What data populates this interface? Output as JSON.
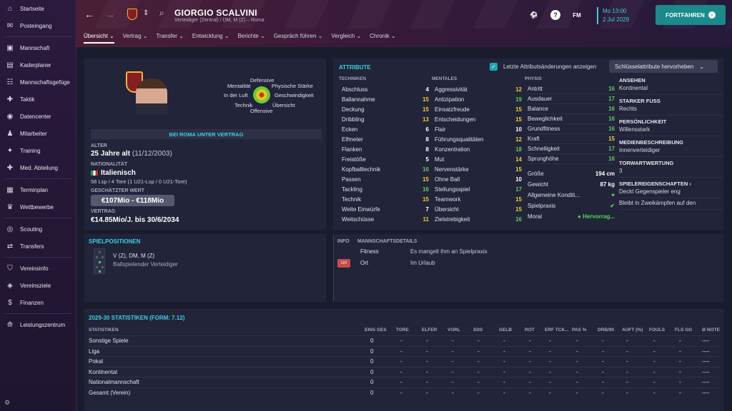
{
  "sidebar": {
    "items": [
      {
        "label": "Startseite",
        "icon": "home-icon"
      },
      {
        "label": "Posteingang",
        "icon": "inbox-icon"
      },
      {
        "label": "Mannschaft",
        "icon": "shirt-icon"
      },
      {
        "label": "Kaderplaner",
        "icon": "clipboard-icon"
      },
      {
        "label": "Mannschaftsgefüge",
        "icon": "people-icon"
      },
      {
        "label": "Taktik",
        "icon": "tactics-icon"
      },
      {
        "label": "Datencenter",
        "icon": "data-icon"
      },
      {
        "label": "Mitarbeiter",
        "icon": "staff-icon"
      },
      {
        "label": "Training",
        "icon": "training-icon"
      },
      {
        "label": "Med. Abteilung",
        "icon": "medical-icon"
      },
      {
        "label": "Terminplan",
        "icon": "calendar-icon"
      },
      {
        "label": "Wettbewerbe",
        "icon": "trophy-icon"
      },
      {
        "label": "Scouting",
        "icon": "scouting-icon"
      },
      {
        "label": "Transfers",
        "icon": "transfer-icon"
      },
      {
        "label": "Vereinsinfo",
        "icon": "shield-icon"
      },
      {
        "label": "Vereinsziele",
        "icon": "target-icon"
      },
      {
        "label": "Finanzen",
        "icon": "money-icon"
      },
      {
        "label": "Leistungszentrum",
        "icon": "academy-icon"
      }
    ]
  },
  "header": {
    "name": "GIORGIO SCALVINI",
    "subtitle": "Verteidiger (Zentral) / DM, M (Z) – Roma",
    "time": "Mo 13:00",
    "date": "2 Jul 2029",
    "fm_label": "FM",
    "help_label": "?",
    "continue_label": "FORTFAHREN",
    "tabs": [
      "Übersicht",
      "Vertrag",
      "Transfer",
      "Entwicklung",
      "Berichte",
      "Gespräch führen",
      "Vergleich",
      "Chronik"
    ]
  },
  "profile": {
    "radar_labels": {
      "top": "Defensive",
      "tl": "Mentalität",
      "tr": "Physische Stärke",
      "l": "In der Luft",
      "r": "Geschwindigkeit",
      "bl": "Technik",
      "br": "Übersicht",
      "bottom": "Offensive"
    },
    "contract_banner": "BEI ROMA UNTER VERTRAG",
    "age_label": "ALTER",
    "age": "25 Jahre alt",
    "dob": "(11/12/2003)",
    "nat_label": "NATIONALITÄT",
    "nationality": "Italienisch",
    "caps": "56 Lsp / 4 Tore (1 U21-Lsp / 0 U21-Tore)",
    "value_label": "GESCHÄTZTER WERT",
    "value": "€107Mio - €118Mio",
    "contract_label": "VERTRAG",
    "contract": "€14.85Mio/J. bis 30/6/2034"
  },
  "attributes": {
    "title": "ATTRIBUTE",
    "show_changes": "Letzte Attributsänderungen anzeigen",
    "key_button": "Schlüsselattribute hervorheben",
    "technik_head": "TECHNIKEN",
    "mental_head": "MENTALES",
    "physis_head": "PHYSIS",
    "technik": [
      {
        "n": "Abschluss",
        "v": "4"
      },
      {
        "n": "Ballannahme",
        "v": "15"
      },
      {
        "n": "Deckung",
        "v": "15"
      },
      {
        "n": "Dribbling",
        "v": "13"
      },
      {
        "n": "Ecken",
        "v": "6"
      },
      {
        "n": "Elfmeter",
        "v": "8"
      },
      {
        "n": "Flanken",
        "v": "8"
      },
      {
        "n": "Freistöße",
        "v": "5"
      },
      {
        "n": "Kopfballtechnik",
        "v": "16"
      },
      {
        "n": "Passen",
        "v": "15"
      },
      {
        "n": "Tackling",
        "v": "16"
      },
      {
        "n": "Technik",
        "v": "15"
      },
      {
        "n": "Weite Einwürfe",
        "v": "7"
      },
      {
        "n": "Weitschüsse",
        "v": "11"
      }
    ],
    "mental": [
      {
        "n": "Aggressivität",
        "v": "12"
      },
      {
        "n": "Antizipation",
        "v": "19"
      },
      {
        "n": "Einsatzfreude",
        "v": "15"
      },
      {
        "n": "Entscheidungen",
        "v": "15"
      },
      {
        "n": "Flair",
        "v": "10"
      },
      {
        "n": "Führungsqualitäten",
        "v": "12"
      },
      {
        "n": "Konzentration",
        "v": "18"
      },
      {
        "n": "Mut",
        "v": "14"
      },
      {
        "n": "Nervenstärke",
        "v": "15"
      },
      {
        "n": "Ohne Ball",
        "v": "10"
      },
      {
        "n": "Stellungsspiel",
        "v": "17"
      },
      {
        "n": "Teamwork",
        "v": "15"
      },
      {
        "n": "Übersicht",
        "v": "15"
      },
      {
        "n": "Zielstrebigkeit",
        "v": "16"
      }
    ],
    "physis": [
      {
        "n": "Antritt",
        "v": "16"
      },
      {
        "n": "Ausdauer",
        "v": "17"
      },
      {
        "n": "Balance",
        "v": "16"
      },
      {
        "n": "Beweglichkeit",
        "v": "16"
      },
      {
        "n": "Grundfitness",
        "v": "16"
      },
      {
        "n": "Kraft",
        "v": "15"
      },
      {
        "n": "Schnelligkeit",
        "v": "17"
      },
      {
        "n": "Sprunghöhe",
        "v": "16"
      }
    ],
    "extra": [
      {
        "n": "Größe",
        "v": "194 cm"
      },
      {
        "n": "Gewicht",
        "v": "87 kg"
      },
      {
        "n": "Allgemeine Konditi...",
        "v": "♥"
      },
      {
        "n": "Spielpraxis",
        "v": "✔"
      },
      {
        "n": "Moral",
        "v": "● Hervorrag..."
      }
    ],
    "right": [
      {
        "h": "ANSEHEN",
        "v": "Kontinental"
      },
      {
        "h": "STARKER FUSS",
        "v": "Rechts"
      },
      {
        "h": "PERSÖNLICHKEIT",
        "v": "Willensstark"
      },
      {
        "h": "MEDIENBESCHREIBUNG",
        "v": "Innenverteidiger"
      },
      {
        "h": "TORWARTWERTUNG",
        "v": "3"
      },
      {
        "h": "SPIELEREIGENSCHAFTEN ›",
        "v": "Deckt Gegenspieler eng"
      },
      {
        "h": "",
        "v": "Bleibt in Zweikämpfen auf den"
      }
    ]
  },
  "positions": {
    "title": "SPIELPOSITIONEN",
    "pos": "V (Z), DM, M (Z)",
    "role": "Ballspielender Verteidiger"
  },
  "info": {
    "tab_info": "INFO",
    "tab_details": "MANNSCHAFTSDETAILS",
    "rows": [
      {
        "k": "Fitness",
        "v": "Es mangelt ihm an Spielpraxis",
        "badge": ""
      },
      {
        "k": "Ort",
        "v": "Im Urlaub",
        "badge": "Url"
      }
    ]
  },
  "stats": {
    "title": "2029-30 STATISTIKEN (FORM: 7.12)",
    "headers": [
      "STATISTIKEN",
      "EINS GES",
      "TORE",
      "ELFER",
      "VORL",
      "SDS",
      "GELB",
      "ROT",
      "ERF TCK...",
      "PAS %",
      "DRB/90",
      "AUFT (%)",
      "FOULS",
      "FLS GG",
      "Ø NOTE"
    ],
    "rows": [
      {
        "name": "Sonstige Spiele",
        "apps": "0",
        "d": "-",
        "note": "----"
      },
      {
        "name": "Liga",
        "apps": "0",
        "d": "-",
        "note": "----"
      },
      {
        "name": "Pokal",
        "apps": "0",
        "d": "-",
        "note": "----"
      },
      {
        "name": "Kontinental",
        "apps": "0",
        "d": "-",
        "note": "----"
      },
      {
        "name": "Nationalmannschaft",
        "apps": "0",
        "d": "-",
        "note": "----"
      },
      {
        "name": "Gesamt (Verein)",
        "apps": "0",
        "d": "-",
        "note": "----"
      }
    ]
  }
}
